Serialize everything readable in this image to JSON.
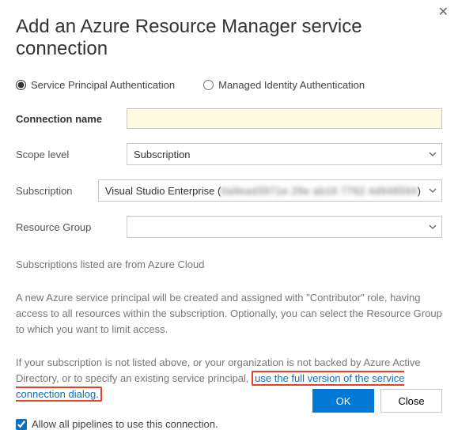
{
  "title": "Add an Azure Resource Manager service connection",
  "auth": {
    "principal": "Service Principal Authentication",
    "managed": "Managed Identity Authentication"
  },
  "labels": {
    "connectionName": "Connection name",
    "scopeLevel": "Scope level",
    "subscription": "Subscription",
    "resourceGroup": "Resource Group"
  },
  "values": {
    "connectionName": "",
    "scopeLevel": "Subscription",
    "subscriptionVisible": "Visual Studio Enterprise ( ",
    "subscriptionObscured": "0a9ead3971e 29e ab19 7762 4d948594",
    "subscriptionSuffix": ")",
    "resourceGroup": ""
  },
  "info": {
    "cloud": "Subscriptions listed are from Azure Cloud",
    "principal": "A new Azure service principal will be created and assigned with \"Contributor\" role, having access to all resources within the subscription. Optionally, you can select the Resource Group to which you want to limit access.",
    "fallbackPrefix": "If your subscription is not listed above, or your organization is not backed by Azure Active Directory, or to specify an existing service principal, ",
    "fallbackLink": "use the full version of the service connection dialog."
  },
  "allowAll": "Allow all pipelines to use this connection.",
  "buttons": {
    "ok": "OK",
    "close": "Close"
  }
}
